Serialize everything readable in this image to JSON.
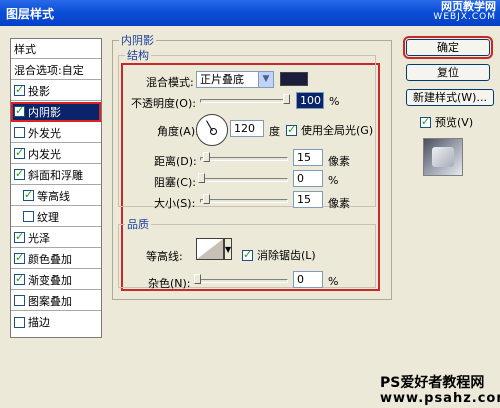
{
  "window": {
    "title": "图层样式"
  },
  "watermark_top": {
    "line1": "网页教学网",
    "line2": "WEBJX.COM"
  },
  "styles_panel": {
    "header": "样式",
    "blend_options": "混合选项:自定",
    "items": [
      {
        "label": "投影",
        "checked": true
      },
      {
        "label": "内阴影",
        "checked": true,
        "selected": true
      },
      {
        "label": "外发光",
        "checked": false
      },
      {
        "label": "内发光",
        "checked": true
      },
      {
        "label": "斜面和浮雕",
        "checked": true
      },
      {
        "label": "等高线",
        "checked": true,
        "indent": true
      },
      {
        "label": "纹理",
        "checked": false,
        "indent": true
      },
      {
        "label": "光泽",
        "checked": true
      },
      {
        "label": "颜色叠加",
        "checked": true
      },
      {
        "label": "渐变叠加",
        "checked": true
      },
      {
        "label": "图案叠加",
        "checked": false
      },
      {
        "label": "描边",
        "checked": false
      }
    ]
  },
  "inner_shadow": {
    "group_title": "内阴影",
    "structure": {
      "title": "结构",
      "blend_mode_label": "混合模式:",
      "blend_mode_value": "正片叠底",
      "color_swatch": "#1b1d3a",
      "opacity_label": "不透明度(O):",
      "opacity_value": "100",
      "opacity_unit": "%",
      "angle_label": "角度(A):",
      "angle_value": "120",
      "angle_unit": "度",
      "global_light_label": "使用全局光(G)",
      "global_light_checked": true,
      "distance_label": "距离(D):",
      "distance_value": "15",
      "distance_unit": "像素",
      "choke_label": "阻塞(C):",
      "choke_value": "0",
      "choke_unit": "%",
      "size_label": "大小(S):",
      "size_value": "15",
      "size_unit": "像素"
    },
    "quality": {
      "title": "品质",
      "contour_label": "等高线:",
      "anti_alias_label": "消除锯齿(L)",
      "anti_alias_checked": true,
      "noise_label": "杂色(N):",
      "noise_value": "0",
      "noise_unit": "%"
    }
  },
  "buttons": {
    "ok": "确定",
    "reset": "复位",
    "new_style": "新建样式(W)...",
    "preview_label": "预览(V)",
    "preview_checked": true
  },
  "footer": {
    "line1": "PS爱好者教程网",
    "line2": "www.psahz.com"
  },
  "colors": {
    "accent_red": "#c82828",
    "title_blue": "#0a4fd6",
    "selection": "#0a246a"
  }
}
